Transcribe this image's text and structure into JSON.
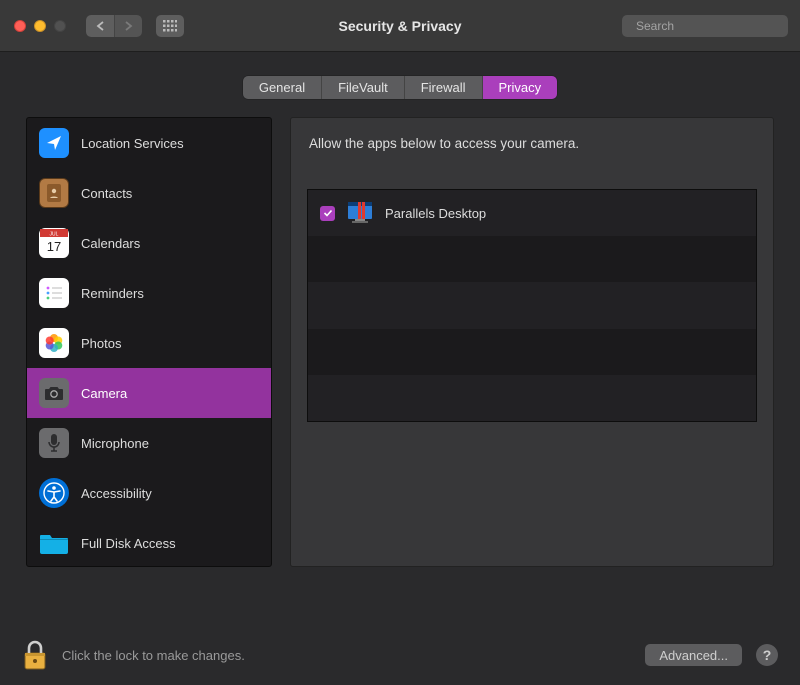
{
  "window": {
    "title": "Security & Privacy",
    "search_placeholder": "Search"
  },
  "tabs": [
    {
      "label": "General",
      "active": false
    },
    {
      "label": "FileVault",
      "active": false
    },
    {
      "label": "Firewall",
      "active": false
    },
    {
      "label": "Privacy",
      "active": true
    }
  ],
  "sidebar": {
    "items": [
      {
        "label": "Location Services",
        "icon": "location-arrow-icon",
        "color": "#1e90ff"
      },
      {
        "label": "Contacts",
        "icon": "address-book-icon",
        "color": "#8b5a2b"
      },
      {
        "label": "Calendars",
        "icon": "calendar-icon",
        "color": "#ffffff"
      },
      {
        "label": "Reminders",
        "icon": "reminders-icon",
        "color": "#ffffff"
      },
      {
        "label": "Photos",
        "icon": "photos-icon",
        "color": "#ffffff"
      },
      {
        "label": "Camera",
        "icon": "camera-icon",
        "color": "#6b6b6d",
        "selected": true
      },
      {
        "label": "Microphone",
        "icon": "microphone-icon",
        "color": "#6b6b6d"
      },
      {
        "label": "Accessibility",
        "icon": "accessibility-icon",
        "color": "#006fd6"
      },
      {
        "label": "Full Disk Access",
        "icon": "folder-icon",
        "color": "#14b0e6"
      }
    ]
  },
  "content": {
    "prompt": "Allow the apps below to access your camera.",
    "apps": [
      {
        "name": "Parallels Desktop",
        "checked": true,
        "icon": "parallels-icon"
      }
    ]
  },
  "footer": {
    "lock_text": "Click the lock to make changes.",
    "advanced_label": "Advanced...",
    "help_label": "?"
  }
}
